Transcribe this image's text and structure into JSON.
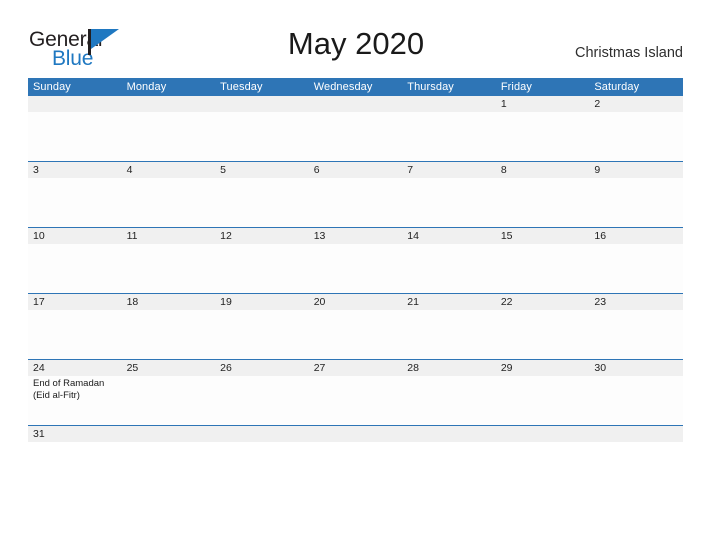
{
  "brand": {
    "name_part1": "General",
    "name_part2": "Blue",
    "flag_icon": "flag-icon",
    "accent_color": "#1f78c1"
  },
  "header": {
    "month_title": "May 2020",
    "locale_title": "Christmas Island"
  },
  "theme": {
    "header_blue": "#2e75b6",
    "row_gray": "#f0f0f0",
    "separator_blue": "#2e75b6",
    "page_background": "#ffffff"
  },
  "calendar": {
    "weekdays": [
      "Sunday",
      "Monday",
      "Tuesday",
      "Wednesday",
      "Thursday",
      "Friday",
      "Saturday"
    ],
    "weeks": [
      {
        "dates": [
          "",
          "",
          "",
          "",
          "",
          "1",
          "2"
        ],
        "events": [
          [],
          [],
          [],
          [],
          [],
          [],
          []
        ]
      },
      {
        "dates": [
          "3",
          "4",
          "5",
          "6",
          "7",
          "8",
          "9"
        ],
        "events": [
          [],
          [],
          [],
          [],
          [],
          [],
          []
        ]
      },
      {
        "dates": [
          "10",
          "11",
          "12",
          "13",
          "14",
          "15",
          "16"
        ],
        "events": [
          [],
          [],
          [],
          [],
          [],
          [],
          []
        ]
      },
      {
        "dates": [
          "17",
          "18",
          "19",
          "20",
          "21",
          "22",
          "23"
        ],
        "events": [
          [],
          [],
          [],
          [],
          [],
          [],
          []
        ]
      },
      {
        "dates": [
          "24",
          "25",
          "26",
          "27",
          "28",
          "29",
          "30"
        ],
        "events": [
          [
            "End of Ramadan",
            "(Eid al-Fitr)"
          ],
          [],
          [],
          [],
          [],
          [],
          []
        ]
      },
      {
        "dates": [
          "31",
          "",
          "",
          "",
          "",
          "",
          ""
        ],
        "events": [
          [],
          [],
          [],
          [],
          [],
          [],
          []
        ]
      }
    ]
  }
}
